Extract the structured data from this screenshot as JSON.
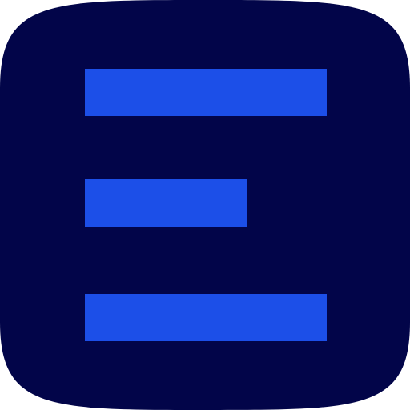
{
  "icon": {
    "name": "menu-lines-app-icon",
    "colors": {
      "background": "#020549",
      "bar": "#1c4fe8"
    },
    "glyph": "three horizontal bars (long, short, long)"
  }
}
